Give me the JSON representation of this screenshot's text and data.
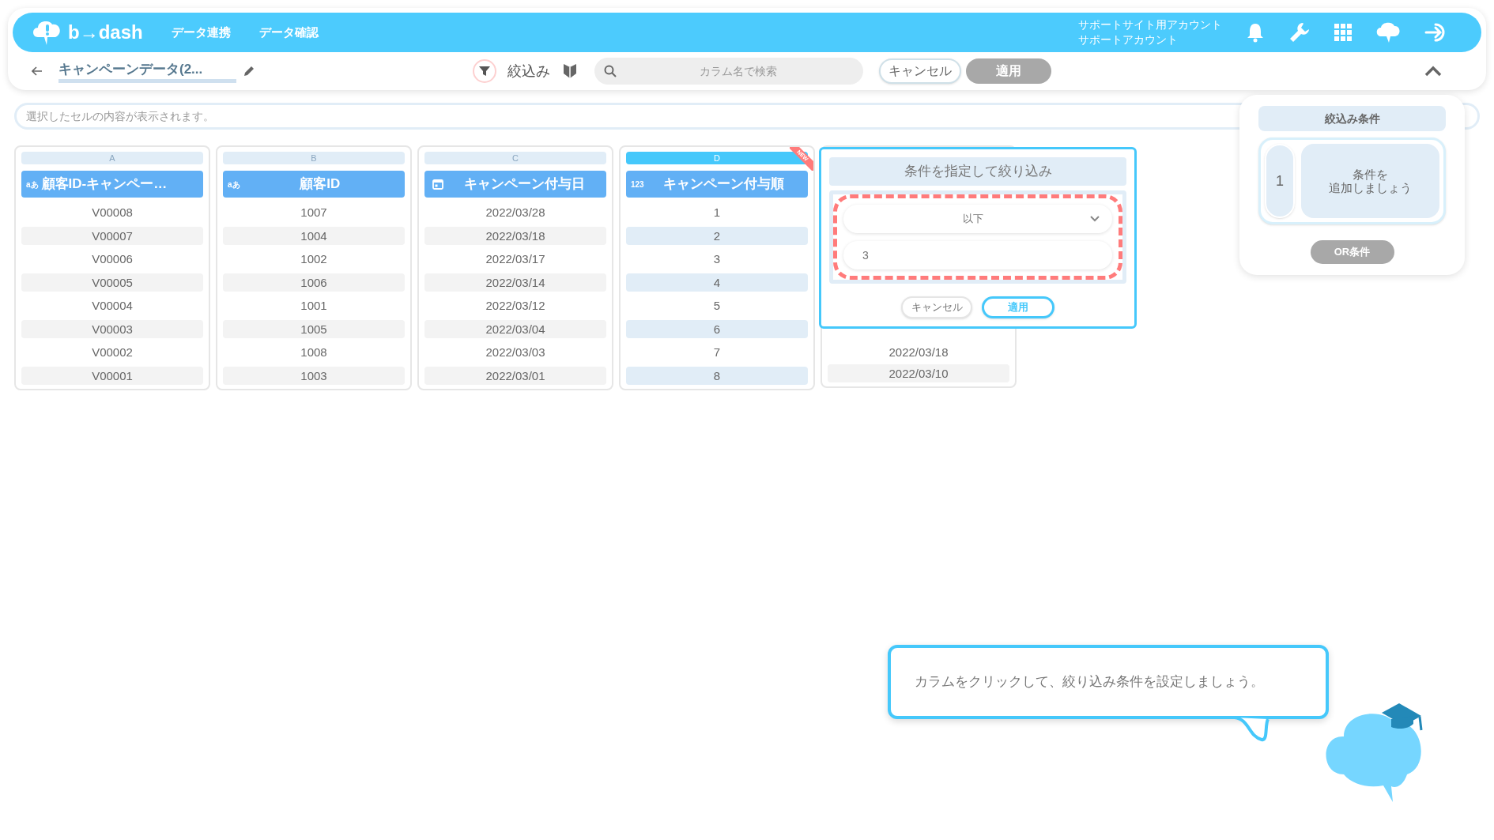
{
  "header": {
    "logo": "b→dash",
    "nav": [
      "データ連携",
      "データ確認"
    ],
    "account": [
      "サポートサイト用アカウント",
      "サポートアカウント"
    ]
  },
  "toolbar": {
    "title": "キャンペーンデータ(2...",
    "filter_label": "絞込み",
    "search_placeholder": "カラム名で検索",
    "cancel": "キャンセル",
    "apply": "適用"
  },
  "cell_bar": {
    "placeholder": "選択したセルの内容が表示されます。"
  },
  "columns": [
    {
      "letter": "A",
      "kind": "text",
      "type_label": "aあ",
      "name": "顧客ID-キャンペー…",
      "selected": false,
      "cells": [
        "V00008",
        "V00007",
        "V00006",
        "V00005",
        "V00004",
        "V00003",
        "V00002",
        "V00001"
      ]
    },
    {
      "letter": "B",
      "kind": "text",
      "type_label": "aあ",
      "name": "顧客ID",
      "selected": false,
      "cells": [
        "1007",
        "1004",
        "1002",
        "1006",
        "1001",
        "1005",
        "1008",
        "1003"
      ]
    },
    {
      "letter": "C",
      "kind": "date",
      "name": "キャンペーン付与日",
      "selected": false,
      "cells": [
        "2022/03/28",
        "2022/03/18",
        "2022/03/17",
        "2022/03/14",
        "2022/03/12",
        "2022/03/04",
        "2022/03/03",
        "2022/03/01"
      ]
    },
    {
      "letter": "D",
      "kind": "number",
      "type_label": "123",
      "name": "キャンペーン付与順",
      "selected": true,
      "badge": "NEW",
      "cells": [
        "1",
        "2",
        "3",
        "4",
        "5",
        "6",
        "7",
        "8"
      ]
    }
  ],
  "partial_column": {
    "cells": [
      "2022/03/18",
      "2022/03/10"
    ]
  },
  "filter_popover": {
    "title": "条件を指定して絞り込み",
    "operator": "以下",
    "value": "3",
    "cancel": "キャンセル",
    "apply": "適用"
  },
  "conditions_panel": {
    "title": "絞込み条件",
    "group_index": "1",
    "placeholder": [
      "条件を",
      "追加しましょう"
    ],
    "or_button": "OR条件"
  },
  "tip": {
    "text": "カラムをクリックして、絞り込み条件を設定しましょう。"
  }
}
